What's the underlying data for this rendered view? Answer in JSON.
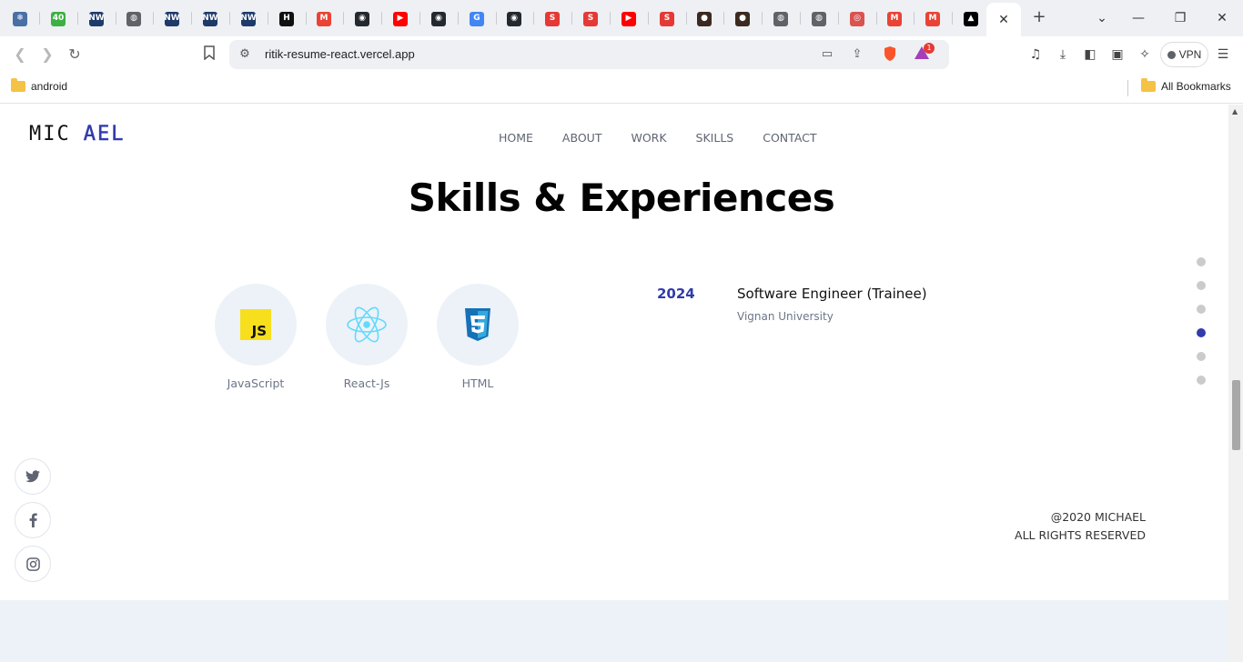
{
  "browser": {
    "tabs": [
      {
        "name": "snowflake-tab-icon",
        "color": "#4a6fa5",
        "glyph": "❄"
      },
      {
        "name": "badge-40-tab-icon",
        "color": "#3cb043",
        "glyph": "40"
      },
      {
        "name": "nxtwave-tab-icon",
        "color": "#1e3a6b",
        "glyph": "NW"
      },
      {
        "name": "globe-tab-icon",
        "color": "#5f6368",
        "glyph": "◍"
      },
      {
        "name": "nxtwave-tab-icon",
        "color": "#1e3a6b",
        "glyph": "NW"
      },
      {
        "name": "nxtwave-tab-icon",
        "color": "#1e3a6b",
        "glyph": "NW"
      },
      {
        "name": "nxtwave-tab-icon",
        "color": "#1e3a6b",
        "glyph": "NW"
      },
      {
        "name": "hackerrank-tab-icon",
        "color": "#111111",
        "glyph": "H"
      },
      {
        "name": "gmail-tab-icon",
        "color": "#ea4335",
        "glyph": "M"
      },
      {
        "name": "github-tab-icon",
        "color": "#24292f",
        "glyph": "◉"
      },
      {
        "name": "youtube-tab-icon",
        "color": "#ff0000",
        "glyph": "▶"
      },
      {
        "name": "github-tab-icon",
        "color": "#24292f",
        "glyph": "◉"
      },
      {
        "name": "google-tab-icon",
        "color": "#4285f4",
        "glyph": "G"
      },
      {
        "name": "github-tab-icon",
        "color": "#24292f",
        "glyph": "◉"
      },
      {
        "name": "s-tab-icon",
        "color": "#e53935",
        "glyph": "S"
      },
      {
        "name": "s-tab-icon",
        "color": "#e53935",
        "glyph": "S"
      },
      {
        "name": "youtube-tab-icon",
        "color": "#ff0000",
        "glyph": "▶"
      },
      {
        "name": "s-tab-icon",
        "color": "#e53935",
        "glyph": "S"
      },
      {
        "name": "person-tab-icon",
        "color": "#3b2a20",
        "glyph": "●"
      },
      {
        "name": "person-tab-icon",
        "color": "#3b2a20",
        "glyph": "●"
      },
      {
        "name": "globe-tab-icon",
        "color": "#5f6368",
        "glyph": "◍"
      },
      {
        "name": "globe-tab-icon",
        "color": "#5f6368",
        "glyph": "◍"
      },
      {
        "name": "shield-tab-icon",
        "color": "#d9534f",
        "glyph": "◎"
      },
      {
        "name": "gmail-tab-icon",
        "color": "#ea4335",
        "glyph": "M"
      },
      {
        "name": "gmail-tab-icon",
        "color": "#ea4335",
        "glyph": "M"
      },
      {
        "name": "vercel-tab-icon",
        "color": "#000000",
        "glyph": "▲"
      }
    ],
    "url": "ritik-resume-react.vercel.app",
    "vpn_label": "VPN",
    "brave_badge": "1",
    "bookmarks": {
      "left_folder": "android",
      "right_folder": "All Bookmarks"
    }
  },
  "site": {
    "logo_part1": "MIC",
    "logo_part2": "AEL",
    "nav": [
      "HOME",
      "ABOUT",
      "WORK",
      "SKILLS",
      "CONTACT"
    ],
    "heading": "Skills & Experiences",
    "skills": [
      {
        "name": "JavaScript",
        "icon": "javascript-icon"
      },
      {
        "name": "React-Js",
        "icon": "react-icon"
      },
      {
        "name": "HTML",
        "icon": "css3-icon"
      }
    ],
    "experience": {
      "year": "2024",
      "title": "Software Engineer (Trainee)",
      "company": "Vignan University"
    },
    "active_section_index": 3,
    "copyright_line1": "@2020 MICHAEL",
    "copyright_line2": "ALL RIGHTS RESERVED",
    "accent_color": "#313bac"
  }
}
